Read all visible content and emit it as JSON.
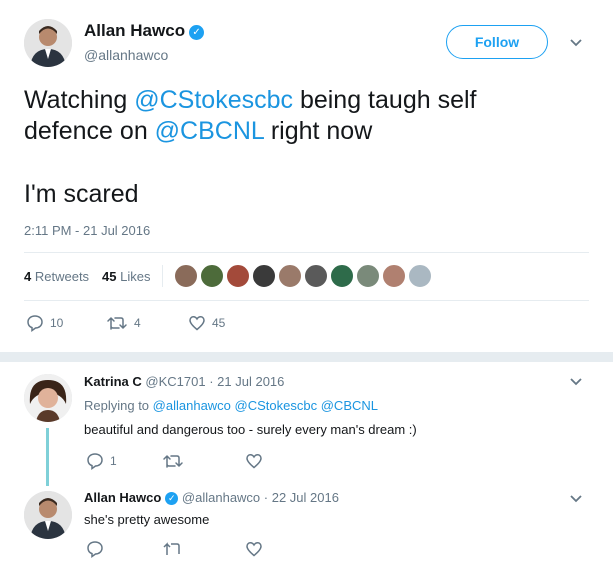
{
  "main_tweet": {
    "name": "Allan Hawco",
    "handle": "@allanhawco",
    "follow_label": "Follow",
    "text_parts": [
      "Watching ",
      "@CStokescbc",
      " being taugh self",
      "defence on ",
      "@CBCNL",
      " right now"
    ],
    "text_second": "I'm scared",
    "timestamp": "2:11 PM - 21 Jul 2016",
    "retweets_count": "4",
    "retweets_label": "Retweets",
    "likes_count": "45",
    "likes_label": "Likes",
    "reply_count": "10",
    "retweet_action_count": "4",
    "like_action_count": "45"
  },
  "reply1": {
    "name": "Katrina C",
    "handle": "@KC1701",
    "date": "· 21 Jul 2016",
    "replying_prefix": "Replying to",
    "replying_to": [
      "@allanhawco",
      "@CStokescbc",
      "@CBCNL"
    ],
    "text": "beautiful and dangerous too - surely every man's dream :)",
    "reply_count": "1"
  },
  "reply2": {
    "name": "Allan Hawco",
    "handle": "@allanhawco",
    "date": "· 22 Jul 2016",
    "text": "she's pretty awesome"
  },
  "colors": {
    "accent": "#1da1f2",
    "link": "#1b95e0",
    "muted": "#657786",
    "divider": "#e6ecf0",
    "thread_line": "#7fd0d8"
  },
  "likers": [
    "#8a6b5a",
    "#4d6b3a",
    "#a34a3a",
    "#3a3a3a",
    "#9a7a6a",
    "#5a5a5a",
    "#2e6b4a",
    "#7a8a7a",
    "#b08070",
    "#aab8c2"
  ]
}
